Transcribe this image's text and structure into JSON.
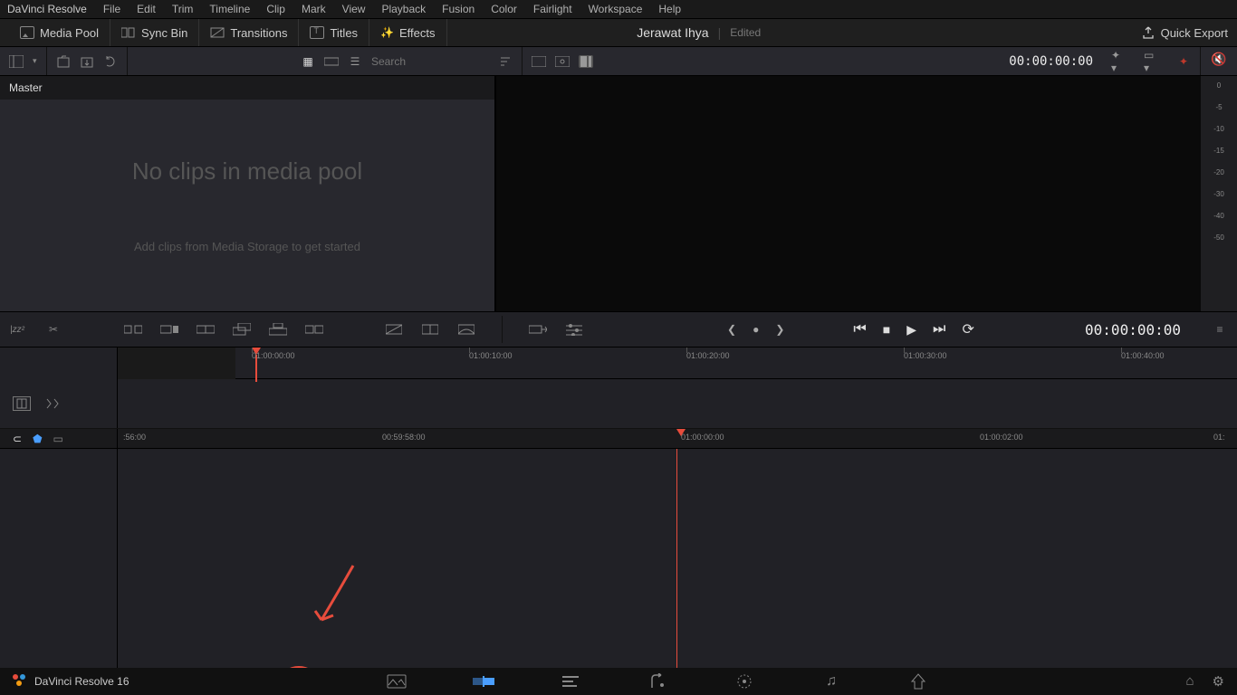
{
  "menu": {
    "app": "DaVinci Resolve",
    "items": [
      "File",
      "Edit",
      "Trim",
      "Timeline",
      "Clip",
      "Mark",
      "View",
      "Playback",
      "Fusion",
      "Color",
      "Fairlight",
      "Workspace",
      "Help"
    ]
  },
  "toolbar": {
    "media_pool": "Media Pool",
    "sync_bin": "Sync Bin",
    "transitions": "Transitions",
    "titles": "Titles",
    "effects": "Effects",
    "project_name": "Jerawat Ihya",
    "project_status": "Edited",
    "quick_export": "Quick Export"
  },
  "search": {
    "placeholder": "Search"
  },
  "viewer": {
    "timecode": "00:00:00:00"
  },
  "media": {
    "master": "Master",
    "empty_title": "No clips in media pool",
    "empty_sub": "Add clips from Media Storage to get started"
  },
  "meter": {
    "labels": [
      "0",
      "-5",
      "-10",
      "-15",
      "-20",
      "-30",
      "-40",
      "-50"
    ]
  },
  "transport": {
    "timecode": "00:00:00:00"
  },
  "ruler1": {
    "marks": [
      {
        "pos": 18,
        "label": "01:00:00:00"
      },
      {
        "pos": 258,
        "label": "01:00:10:00"
      },
      {
        "pos": 498,
        "label": "01:00:20:00"
      },
      {
        "pos": 738,
        "label": "01:00:30:00"
      },
      {
        "pos": 978,
        "label": "01:00:40:00"
      }
    ]
  },
  "ruler2": {
    "marks": [
      {
        "pos": 6,
        "label": ":56:00"
      },
      {
        "pos": 292,
        "label": "00:59:58:00"
      },
      {
        "pos": 622,
        "label": "01:00:00:00"
      },
      {
        "pos": 952,
        "label": "01:00:02:00"
      },
      {
        "pos": 1210,
        "label": "01:"
      }
    ]
  },
  "bottom": {
    "app_version": "DaVinci Resolve 16"
  },
  "icons": {
    "mute": "🔇",
    "magnet": "🧲",
    "shield": "🛡",
    "home": "🏠",
    "gear": "⚙"
  }
}
